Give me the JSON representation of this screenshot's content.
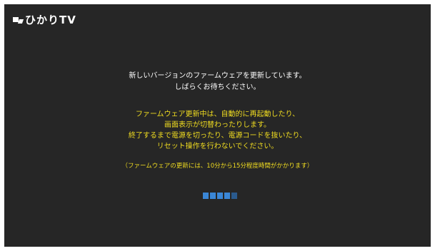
{
  "header": {
    "logo_text": "ひかりTV"
  },
  "update_notice": {
    "line1": "新しいバージョンのファームウェアを更新しています。",
    "line2": "しばらくお待ちください。"
  },
  "warning": {
    "line1": "ファームウェア更新中は、自動的に再起動したり、",
    "line2": "画面表示が切替わったりします。",
    "line3": "終了するまで電源を切ったり、電源コードを抜いたり、",
    "line4": "リセット操作を行わないでください。"
  },
  "duration_note": "（ファームウェアの更新には、10分から15分程度時間がかかります）",
  "progress": {
    "total_segments": 5,
    "active_segments": 4,
    "colors": {
      "active": "#3a86d6",
      "inactive": "#2a5a8e"
    }
  },
  "colors": {
    "background": "#262626",
    "text_primary": "#ffffff",
    "text_warning": "#f0dc20"
  }
}
